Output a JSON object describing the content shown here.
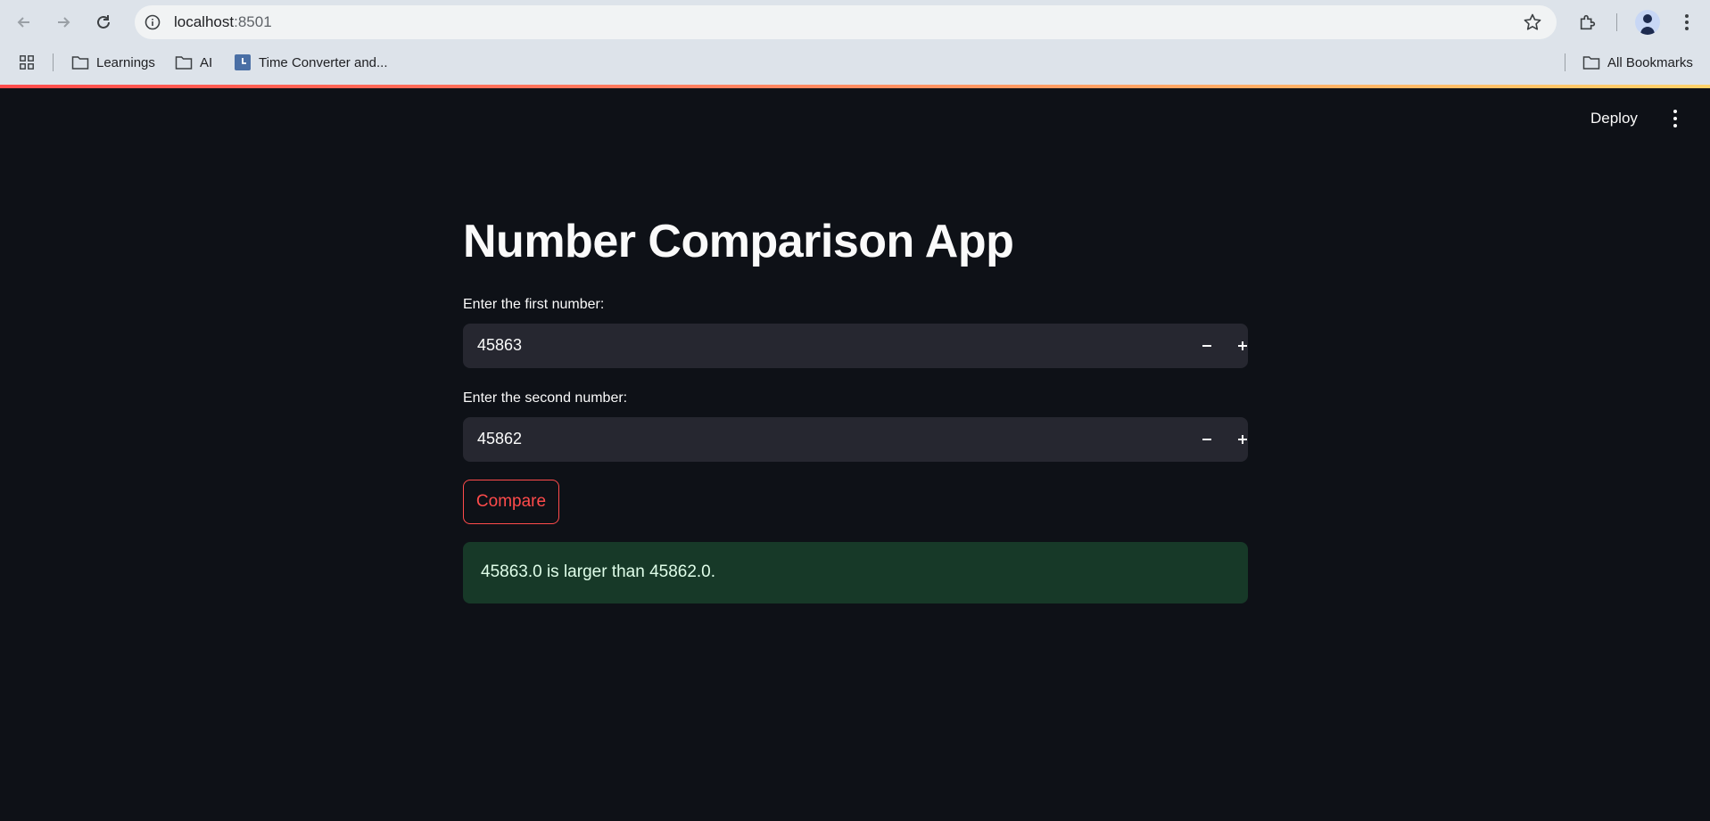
{
  "browser": {
    "url_host": "localhost",
    "url_port": ":8501",
    "bookmarks": [
      {
        "label": "Learnings"
      },
      {
        "label": "AI"
      },
      {
        "label": "Time Converter and..."
      }
    ],
    "all_bookmarks_label": "All Bookmarks"
  },
  "header": {
    "deploy_label": "Deploy"
  },
  "app": {
    "title": "Number Comparison App",
    "first": {
      "label": "Enter the first number:",
      "value": "45863"
    },
    "second": {
      "label": "Enter the second number:",
      "value": "45862"
    },
    "compare_label": "Compare",
    "result": "45863.0 is larger than 45862.0."
  },
  "colors": {
    "background": "#0e1117",
    "input_bg": "#262730",
    "accent": "#ff4b4b",
    "success_bg": "#173928",
    "success_text": "#dffde9"
  },
  "icons": [
    "back-icon",
    "forward-icon",
    "reload-icon",
    "site-info-icon",
    "star-icon",
    "extensions-icon",
    "profile-avatar",
    "menu-icon",
    "apps-grid-icon",
    "folder-icon",
    "clock-icon",
    "kebab-menu-icon",
    "minus-icon",
    "plus-icon"
  ]
}
